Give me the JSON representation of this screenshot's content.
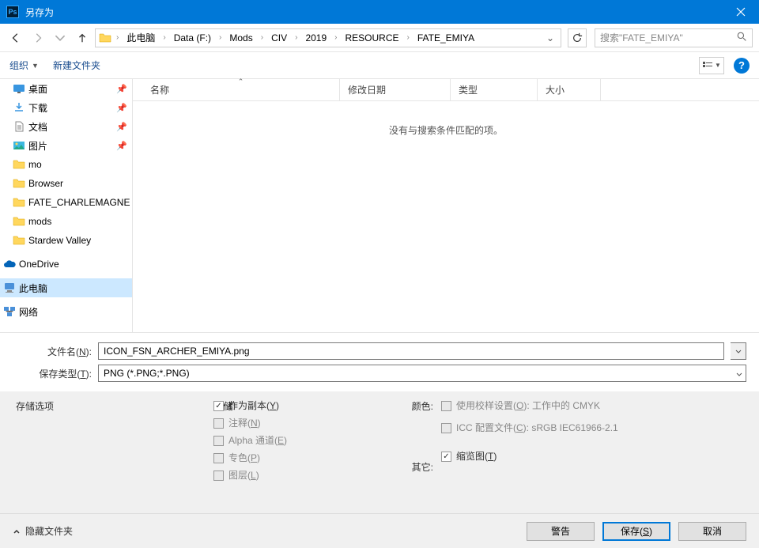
{
  "title": "另存为",
  "breadcrumb": {
    "items": [
      "此电脑",
      "Data (F:)",
      "Mods",
      "CIV",
      "2019",
      "RESOURCE",
      "FATE_EMIYA"
    ]
  },
  "search": {
    "placeholder": "搜索\"FATE_EMIYA\""
  },
  "toolbar": {
    "organize": "组织",
    "new_folder": "新建文件夹"
  },
  "sidebar": {
    "items": [
      {
        "label": "桌面",
        "pinned": true,
        "icon": "desktop"
      },
      {
        "label": "下载",
        "pinned": true,
        "icon": "downloads"
      },
      {
        "label": "文档",
        "pinned": true,
        "icon": "documents"
      },
      {
        "label": "图片",
        "pinned": true,
        "icon": "pictures"
      },
      {
        "label": "mo",
        "pinned": false,
        "icon": "folder"
      },
      {
        "label": "Browser",
        "pinned": false,
        "icon": "folder"
      },
      {
        "label": "FATE_CHARLEMAGNE",
        "pinned": false,
        "icon": "folder"
      },
      {
        "label": "mods",
        "pinned": false,
        "icon": "folder"
      },
      {
        "label": "Stardew Valley",
        "pinned": false,
        "icon": "folder"
      }
    ],
    "onedrive": "OneDrive",
    "thispc": "此电脑",
    "network": "网络"
  },
  "columns": {
    "name": "名称",
    "date": "修改日期",
    "type": "类型",
    "size": "大小"
  },
  "empty_message": "没有与搜索条件匹配的项。",
  "filename": {
    "label": "文件名(",
    "label_hotkey": "N",
    "label_suffix": "):",
    "value": "ICON_FSN_ARCHER_EMIYA.png"
  },
  "filetype": {
    "label": "保存类型(",
    "label_hotkey": "T",
    "label_suffix": "):",
    "value": "PNG (*.PNG;*.PNG)"
  },
  "options": {
    "save_options": "存储选项",
    "save": "存储:",
    "as_copy": "作为副本(",
    "as_copy_hk": "Y",
    "notes": "注释(",
    "notes_hk": "N",
    "alpha": "Alpha 通道(",
    "alpha_hk": "E",
    "spot": "专色(",
    "spot_hk": "P",
    "layers": "图层(",
    "layers_hk": "L",
    "color": "颜色:",
    "proof": "使用校样设置(",
    "proof_hk": "O",
    "proof_suffix": "):  工作中的 CMYK",
    "icc": "ICC 配置文件(",
    "icc_hk": "C",
    "icc_suffix": "): sRGB IEC61966-2.1",
    "other": "其它:",
    "thumbnail": "缩览图(",
    "thumbnail_hk": "T",
    "close_paren": ")"
  },
  "footer": {
    "hide": "隐藏文件夹",
    "warning": "警告",
    "save": "保存(",
    "save_hk": "S",
    "cancel": "取消"
  }
}
